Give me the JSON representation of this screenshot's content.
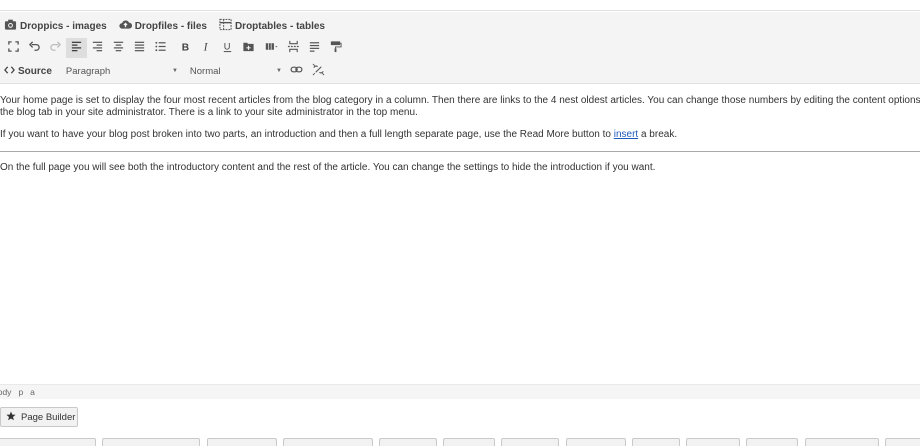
{
  "plugins": [
    {
      "label": "Droppics - images",
      "icon": "camera-icon"
    },
    {
      "label": "Dropfiles - files",
      "icon": "cloud-upload-icon"
    },
    {
      "label": "Droptables - tables",
      "icon": "table-icon"
    }
  ],
  "toolbar": {
    "icons": [
      "fullscreen-icon",
      "undo-icon",
      "redo-icon",
      "align-left-icon",
      "align-right-icon",
      "align-center-icon",
      "align-justify-icon",
      "bullet-list-icon",
      "bold-icon",
      "italic-icon",
      "underline-icon",
      "insert-media-icon",
      "table-insert-icon",
      "page-break-icon",
      "paragraph-icon",
      "format-painter-icon"
    ]
  },
  "row3": {
    "source_label": "Source",
    "format_value": "Paragraph",
    "style_value": "Normal",
    "icons": [
      "link-icon",
      "unlink-icon"
    ]
  },
  "content": {
    "p1_line1": "Your home page is set to display the four most recent articles from the blog category in a column. Then there are links to the 4 nest oldest articles. You can change those numbers by editing the content options se",
    "p1_line2": "the blog tab in your site administrator. There is a link to your site administrator in the top menu.",
    "p2_before": "If you want to have your blog post broken into two parts, an introduction and then a full length separate page, use the Read More button to ",
    "p2_link": "insert",
    "p2_after": " a break.",
    "p3": "On the full page you will see both the introductory content and the rest of the article. You can change the settings to hide the introduction if you want."
  },
  "statusbar": {
    "path": [
      "body",
      "p",
      "a"
    ]
  },
  "page_builder": {
    "label": "Page Builder",
    "icon": "star-icon"
  }
}
